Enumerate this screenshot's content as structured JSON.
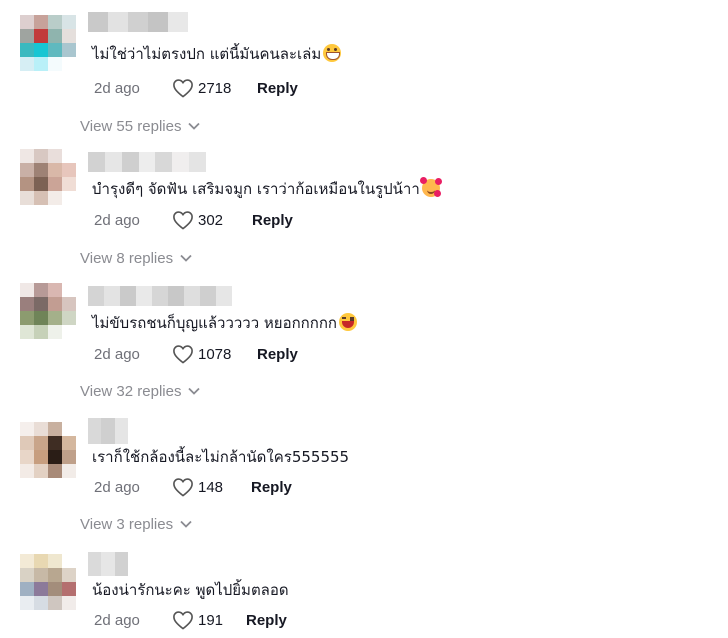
{
  "comments": [
    {
      "avatar": [
        "#ddcfcf",
        "#c7a29a",
        "#b9cdc9",
        "#d8e4e6",
        "#9fa4a0",
        "#c23b3b",
        "#8fb4ae",
        "#e5dfdc",
        "#3bb9bf",
        "#18c6d3",
        "#5fb9bf",
        "#a9c6cf",
        "#d6eef4",
        "#b9f0f8",
        "#f4fbfd",
        "#ffffff"
      ],
      "username_colors": [
        "#c9c9c9",
        "#e2e2e2",
        "#d0d0d0",
        "#c4c4c4",
        "#e8e8e8"
      ],
      "text": "ไม่ใช่ว่าไม่ตรงปก แต่นี้มันคนละเล่ม",
      "emoji": "grin",
      "date": "2d ago",
      "likes": "2718",
      "reply_label": "Reply",
      "view_replies": "View 55 replies"
    },
    {
      "avatar": [
        "#efe7e4",
        "#d8c8c2",
        "#e9dedb",
        "#ffffff",
        "#c9b0a6",
        "#9e8275",
        "#d9b8a8",
        "#e7c6bc",
        "#b49382",
        "#7d6254",
        "#cba497",
        "#f0ddd5",
        "#e8ded8",
        "#d6c0b4",
        "#f3ece8",
        "#ffffff"
      ],
      "username_colors": [
        "#d2d2d2",
        "#e6e6e6",
        "#cfcfcf",
        "#ededed",
        "#d8d8d8",
        "#f0eeee",
        "#e4e4e4"
      ],
      "text": "บำรุงดีๆ จัดฟัน เสริมจมูก เราว่าก้อเหมือนในรูปน้าา",
      "emoji": "love",
      "date": "2d ago",
      "likes": "302",
      "reply_label": "Reply",
      "view_replies": "View 8 replies"
    },
    {
      "avatar": [
        "#f0e8e6",
        "#b79a97",
        "#d9b7b1",
        "#ffffff",
        "#9a7f7d",
        "#7b6a66",
        "#c29d92",
        "#d7c5bf",
        "#8c9b6f",
        "#6f8458",
        "#a4b08a",
        "#cfd6c4",
        "#dfe6d6",
        "#c6d1b8",
        "#eef1ea",
        "#ffffff"
      ],
      "username_colors": [
        "#d4d4d4",
        "#e3e3e3",
        "#cacaca",
        "#e9e9e9",
        "#d6d6d6",
        "#c8c8c8",
        "#dedede",
        "#cfcfcf",
        "#e6e6e6"
      ],
      "text": "ไม่ขับรถชนก็บุญแล้ววววว หยอกกกกก",
      "emoji": "laugh",
      "date": "2d ago",
      "likes": "1078",
      "reply_label": "Reply",
      "view_replies": "View 32 replies"
    },
    {
      "avatar": [
        "#f5efec",
        "#e9ddd6",
        "#c8b09f",
        "#ffffff",
        "#dfc9b8",
        "#c9a58a",
        "#3f2d23",
        "#d4b79e",
        "#e8d6c8",
        "#c79e7f",
        "#2a1d16",
        "#bfa08a",
        "#f3ebe6",
        "#e3d1c3",
        "#a88a78",
        "#f2ece8"
      ],
      "username_colors": [
        "#d9d9d9",
        "#cfcfcf",
        "#e5e5e5"
      ],
      "text": "เราก็ใช้กล้องนี้ละไม่กล้านัดใคร555555",
      "emoji": "",
      "date": "2d ago",
      "likes": "148",
      "reply_label": "Reply",
      "view_replies": "View 3 replies"
    },
    {
      "avatar": [
        "#f3ead6",
        "#e8d8b2",
        "#efe7cf",
        "#ffffff",
        "#d9d2c5",
        "#c7b9a6",
        "#b8a790",
        "#ddd3c7",
        "#9fb0c2",
        "#8c7a9a",
        "#a38d7b",
        "#b46f6f",
        "#e9edf1",
        "#d6dce3",
        "#cfc6c0",
        "#f1ecea"
      ],
      "username_colors": [
        "#dadada",
        "#e6e6e6",
        "#d1d1d1"
      ],
      "text": "น้องน่ารักนะคะ พูดไปยิ้มตลอด",
      "emoji": "",
      "date": "2d ago",
      "likes": "191",
      "reply_label": "Reply",
      "view_replies": ""
    }
  ]
}
